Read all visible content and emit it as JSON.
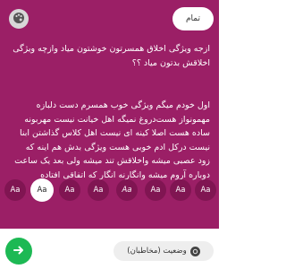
{
  "header": {
    "done_label": "تمام",
    "palette_icon": "palette-icon"
  },
  "post": {
    "question": "ازجه ویژگی اخلاق همسرتون خوشتون میاد وازچه ویژگی اخلاقش بدتون میاد ؟؟",
    "answer": "اول خودم میگم ویژگی خوب همسرم دست دلبازه مهمونواز هست‌دروغ نمیگه اهل خیانت نیست مهربونه ساده هست اصلا کینه ای نیست اهل کلاس گذاشتن ابنا نیست درکل ادم خوبی هست ویژگی بدش هم اینه که زود عصبی میشه واخلاقش تند میشه ولی بعد یک ساعت دوباره آروم میشه وانگارنه انگار که اتفاقی افتاده"
  },
  "font_options": [
    {
      "label": "Aa",
      "selected": false
    },
    {
      "label": "Aa",
      "selected": true
    },
    {
      "label": "Aa",
      "selected": false
    },
    {
      "label": "Aa",
      "selected": false
    },
    {
      "label": "Aa",
      "selected": false
    },
    {
      "label": "Aa",
      "selected": false
    },
    {
      "label": "Aa",
      "selected": false
    },
    {
      "label": "Aa",
      "selected": false
    }
  ],
  "footer": {
    "status_label": "وضعیت (مخاطبان)",
    "send_icon": "arrow-right-icon"
  },
  "colors": {
    "background": "#9b1f66",
    "accent_send": "#1db954"
  }
}
